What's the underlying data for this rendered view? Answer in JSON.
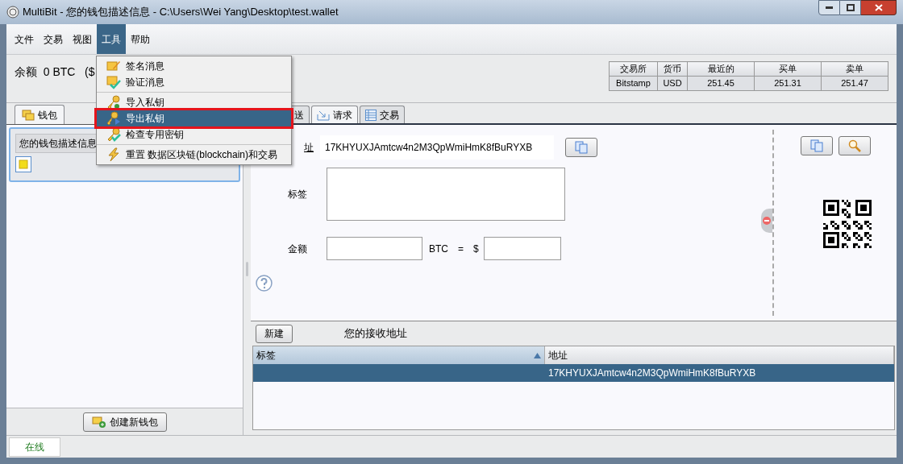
{
  "window": {
    "title": "MultiBit - 您的钱包描述信息 - C:\\Users\\Wei Yang\\Desktop\\test.wallet"
  },
  "menu_bar": [
    {
      "label": "文件",
      "selected": false
    },
    {
      "label": "交易",
      "selected": false
    },
    {
      "label": "视图",
      "selected": false
    },
    {
      "label": "工具",
      "selected": true
    },
    {
      "label": "帮助",
      "selected": false
    }
  ],
  "tools_menu": {
    "groups": [
      [
        {
          "label": "签名消息",
          "kind": "sign",
          "selected": false
        },
        {
          "label": "验证消息",
          "kind": "verify",
          "selected": false
        }
      ],
      [
        {
          "label": "导入私钥",
          "kind": "import",
          "selected": false
        },
        {
          "label": "导出私钥",
          "kind": "export",
          "selected": true
        },
        {
          "label": "检查专用密钥",
          "kind": "check",
          "selected": false
        }
      ],
      [
        {
          "label": "重置 数据区块链(blockchain)和交易",
          "kind": "reset",
          "selected": false
        }
      ]
    ]
  },
  "balance": "余额  0 BTC   ($",
  "exchange_table": {
    "columns": [
      "交易所",
      "货币",
      "最近的",
      "买单",
      "卖单"
    ],
    "rows": [
      [
        "Bitstamp",
        "USD",
        "251.45",
        "251.31",
        "251.47"
      ]
    ]
  },
  "wallet_tabs": [
    {
      "label": "钱包",
      "selected": true
    }
  ],
  "wallets": [
    {
      "description": "您的钱包描述信息",
      "selected": true
    }
  ],
  "create_wallet_button": "创建新钱包",
  "tabs": [
    {
      "label": "送",
      "selected": false
    },
    {
      "label": "请求",
      "selected": true
    },
    {
      "label": "交易",
      "selected": false
    }
  ],
  "request_form": {
    "address_label": "址",
    "address": "17KHYUXJAmtcw4n2M3QpWmiHmK8fBuRYXB",
    "label_label": "标签",
    "amount_label": "金额",
    "currency": "BTC",
    "equals": "=",
    "fiat_symbol": "$"
  },
  "new_button": "新建",
  "addresses_title": "您的接收地址",
  "address_table": {
    "columns": [
      {
        "label": "标签",
        "sorted": true
      },
      {
        "label": "地址"
      }
    ],
    "rows": [
      {
        "address": "17KHYUXJAmtcw4n2M3QpWmiHmK8fBuRYXB",
        "selected": true
      }
    ]
  },
  "status": "在线"
}
